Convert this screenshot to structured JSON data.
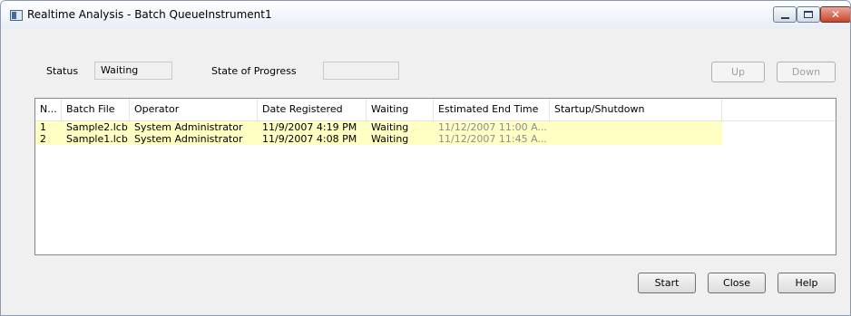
{
  "window": {
    "title": "Realtime Analysis - Batch QueueInstrument1",
    "icon": "app-window-icon"
  },
  "status": {
    "status_label": "Status",
    "status_value": "Waiting",
    "progress_label": "State of Progress",
    "progress_value": ""
  },
  "order_buttons": {
    "up": "Up",
    "down": "Down"
  },
  "table": {
    "columns": [
      "N...",
      "Batch File",
      "Operator",
      "Date Registered",
      "Waiting",
      "Estimated End Time",
      "Startup/Shutdown"
    ],
    "rows": [
      {
        "no": "1",
        "batch_file": "Sample2.lcb",
        "operator": "System Administrator",
        "date_registered": "11/9/2007 4:19 PM",
        "waiting": "Waiting",
        "estimated_end": "11/12/2007 11:00 A...",
        "startup": ""
      },
      {
        "no": "2",
        "batch_file": "Sample1.lcb",
        "operator": "System Administrator",
        "date_registered": "11/9/2007 4:08 PM",
        "waiting": "Waiting",
        "estimated_end": "11/12/2007 11:45 A...",
        "startup": ""
      }
    ],
    "row_highlight_color": "#ffffc4"
  },
  "footer_buttons": {
    "start": "Start",
    "close": "Close",
    "help": "Help"
  }
}
